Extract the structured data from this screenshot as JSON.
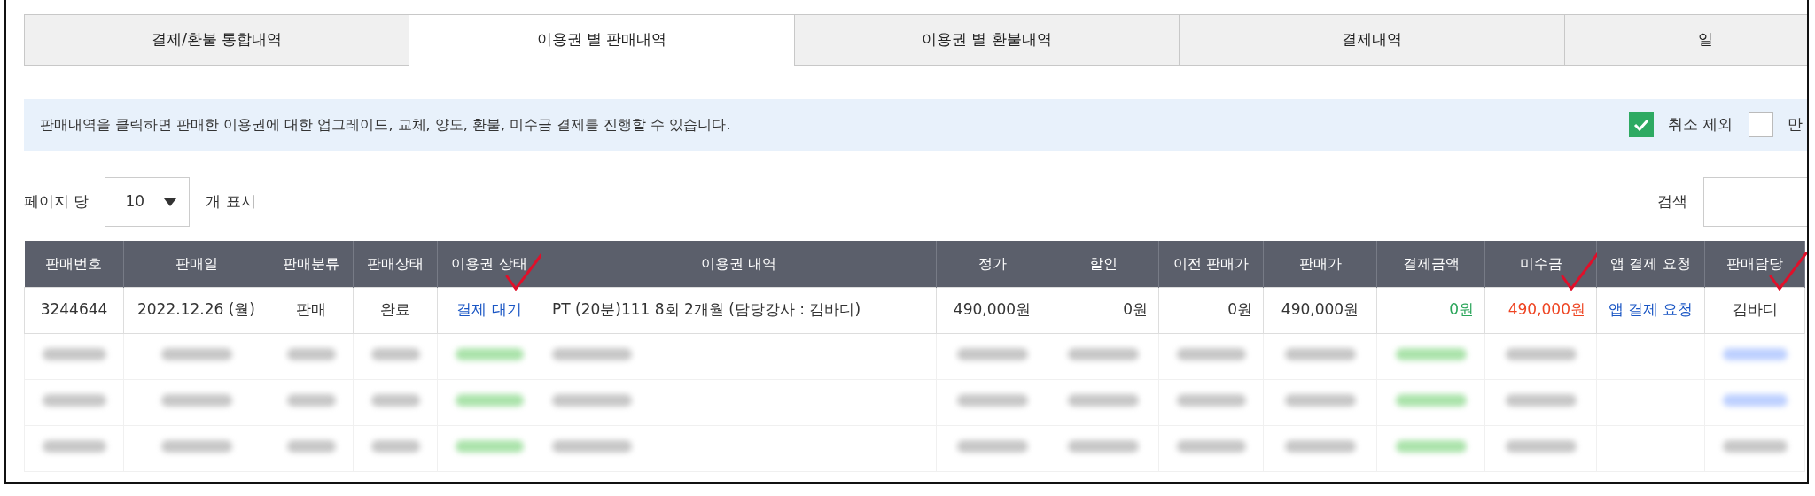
{
  "tabs": [
    {
      "label": "결제/환불 통합내역",
      "selected": false
    },
    {
      "label": "이용권 별 판매내역",
      "selected": true
    },
    {
      "label": "이용권 별 환불내역",
      "selected": false
    },
    {
      "label": "결제내역",
      "selected": false
    },
    {
      "label": "일",
      "selected": false
    }
  ],
  "notice": {
    "text": "판매내역을 클릭하면 판매한 이용권에 대한 업그레이드, 교체, 양도, 환불, 미수금 결제를 진행할 수 있습니다.",
    "filters": [
      {
        "label": "취소 제외",
        "checked": true
      },
      {
        "label": "만",
        "checked": false
      }
    ]
  },
  "page_size": {
    "label": "페이지 당",
    "value": "10",
    "suffix": "개 표시"
  },
  "search": {
    "label": "검색"
  },
  "table": {
    "columns": [
      {
        "label": "판매번호",
        "marked": false
      },
      {
        "label": "판매일",
        "marked": false
      },
      {
        "label": "판매분류",
        "marked": false
      },
      {
        "label": "판매상태",
        "marked": false
      },
      {
        "label": "이용권 상태",
        "marked": true
      },
      {
        "label": "이용권 내역",
        "marked": false
      },
      {
        "label": "정가",
        "marked": false
      },
      {
        "label": "할인",
        "marked": false
      },
      {
        "label": "이전 판매가",
        "marked": false
      },
      {
        "label": "판매가",
        "marked": false
      },
      {
        "label": "결제금액",
        "marked": false
      },
      {
        "label": "미수금",
        "marked": true
      },
      {
        "label": "앱 결제 요청",
        "marked": false
      },
      {
        "label": "판매담당",
        "marked": true
      }
    ],
    "rows": [
      {
        "kind": "data",
        "cells": [
          {
            "text": "3244644",
            "kind": "plain"
          },
          {
            "text": "2022.12.26 (월)",
            "kind": "plain"
          },
          {
            "text": "판매",
            "kind": "plain"
          },
          {
            "text": "완료",
            "kind": "plain"
          },
          {
            "text": "결제 대기",
            "kind": "link"
          },
          {
            "text": "PT (20분)111 8회 2개월 (담당강사 : 김바디)",
            "kind": "plain"
          },
          {
            "text": "490,000원",
            "kind": "plain"
          },
          {
            "text": "0원",
            "kind": "plain"
          },
          {
            "text": "0원",
            "kind": "plain"
          },
          {
            "text": "490,000원",
            "kind": "plain"
          },
          {
            "text": "0원",
            "kind": "paid"
          },
          {
            "text": "490,000원",
            "kind": "due"
          },
          {
            "text": "앱 결제 요청",
            "kind": "link"
          },
          {
            "text": "김바디",
            "kind": "plain"
          }
        ]
      },
      {
        "kind": "blurred"
      },
      {
        "kind": "blurred"
      },
      {
        "kind": "blurred"
      }
    ]
  }
}
